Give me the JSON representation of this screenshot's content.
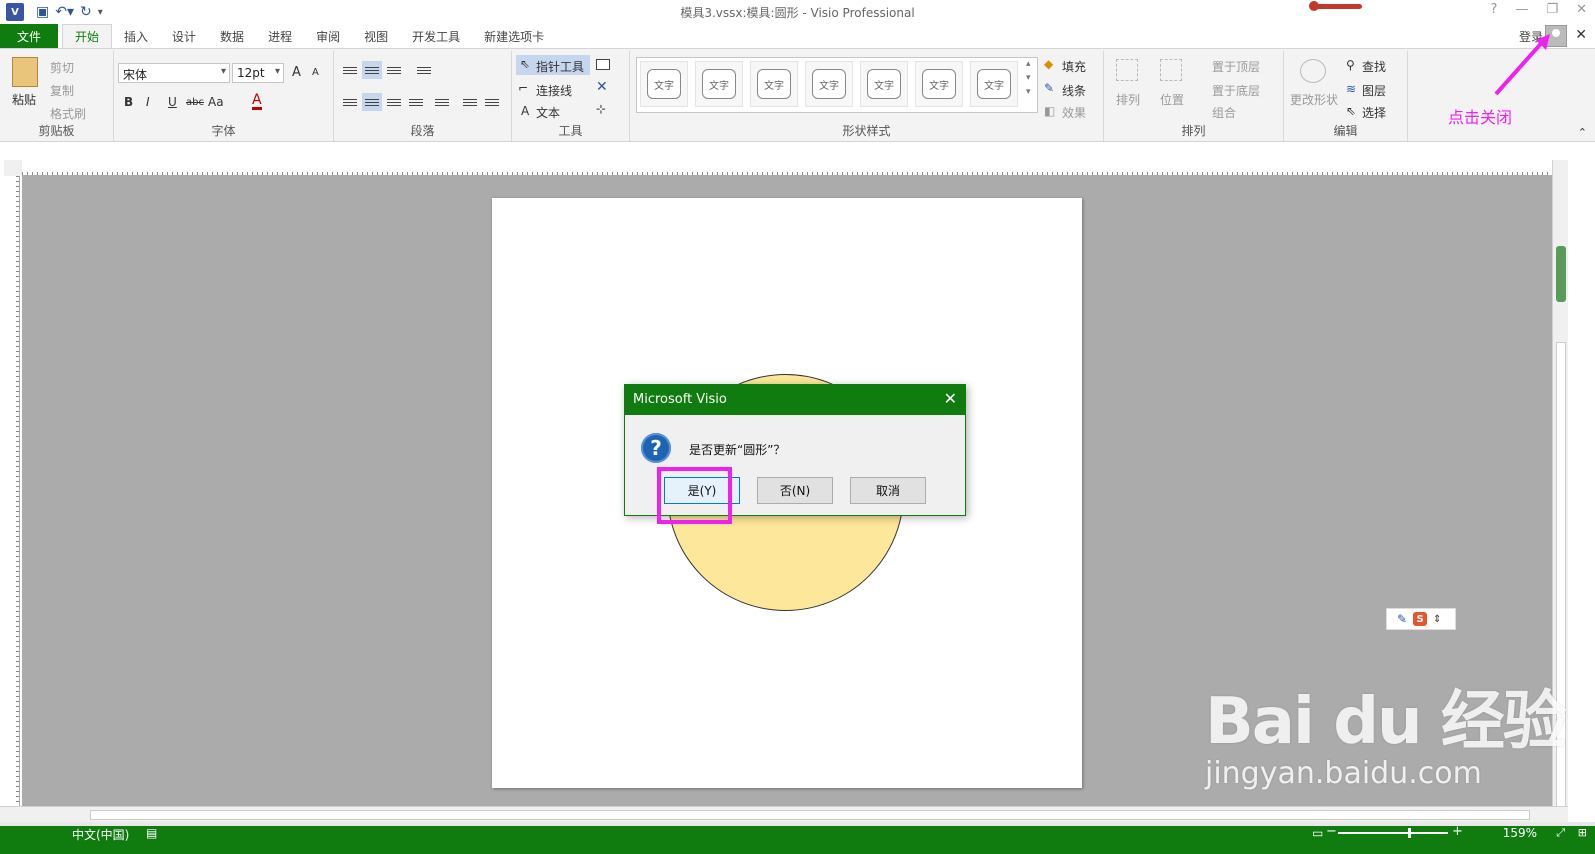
{
  "title_bar": {
    "app_icon": "V",
    "title": "模具3.vssx:模具:圆形 - Visio Professional",
    "qat_icons": [
      "save-icon",
      "undo-icon",
      "redo-icon",
      "customize-icon"
    ],
    "window_controls": [
      "?",
      "—",
      "❐",
      "✕"
    ]
  },
  "tabs": {
    "file": "文件",
    "items": [
      "开始",
      "插入",
      "设计",
      "数据",
      "进程",
      "审阅",
      "视图",
      "开发工具",
      "新建选项卡"
    ],
    "active": "开始",
    "signin": "登录"
  },
  "ribbon": {
    "clipboard": {
      "label": "剪贴板",
      "paste": "粘贴",
      "cut": "剪切",
      "copy": "复制",
      "format_painter": "格式刷"
    },
    "font": {
      "label": "字体",
      "font_name": "宋体",
      "font_size": "12pt",
      "bold": "B",
      "italic": "I",
      "underline": "U",
      "strike": "abc",
      "case": "Aa",
      "color": "A",
      "grow": "A",
      "shrink": "A"
    },
    "paragraph": {
      "label": "段落"
    },
    "tools": {
      "label": "工具",
      "pointer": "指针工具",
      "connector": "连接线",
      "text": "文本",
      "text_icon": "A"
    },
    "shape_styles": {
      "label": "形状样式",
      "swatch_text": "文字",
      "fill": "填充",
      "line": "线条",
      "effects": "效果"
    },
    "arrange": {
      "label": "排列",
      "align": "排列",
      "position": "位置",
      "bring_front": "置于顶层",
      "send_back": "置于底层",
      "group": "组合"
    },
    "editing": {
      "label": "编辑",
      "change_shape": "更改形状",
      "find": "查找",
      "layers": "图层",
      "select": "选择"
    }
  },
  "dialog": {
    "title": "Microsoft Visio",
    "message": "是否更新“圆形”？",
    "icon": "?",
    "yes": "是(Y)",
    "no": "否(N)",
    "cancel": "取消"
  },
  "annotation": "点击关闭",
  "status": {
    "language": "中文(中国)",
    "zoom": "159%"
  },
  "watermark": {
    "logo": "Bai du 经验",
    "url": "jingyan.baidu.com"
  },
  "colors": {
    "accent": "#107c10",
    "highlight": "#ee21ee",
    "shape_fill": "#fde79a"
  }
}
